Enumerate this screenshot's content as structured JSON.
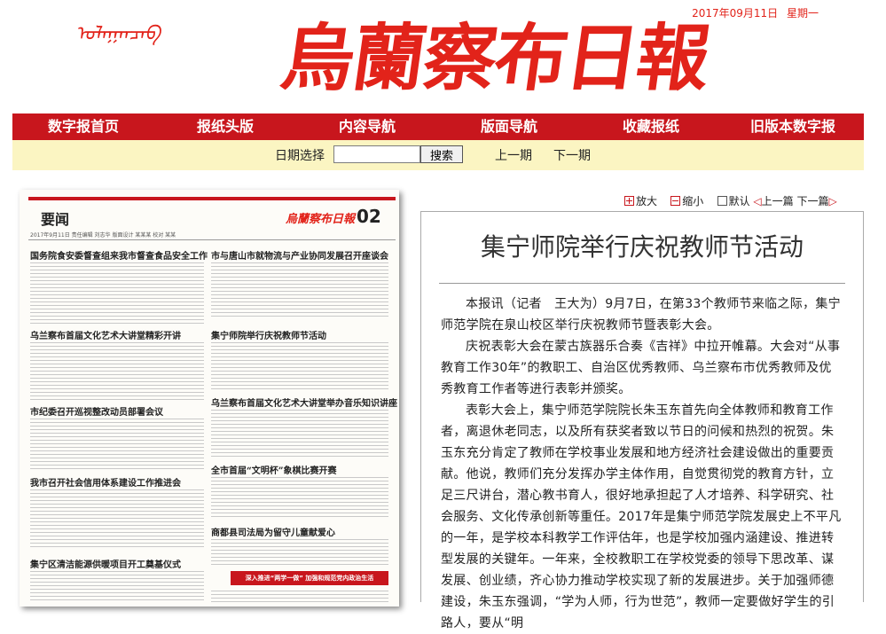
{
  "header": {
    "mongol_script": "ᠤᠯᠠᠭᠠᠨᠴᠠᠪ",
    "paper_name": "烏蘭察布日報",
    "date": "2017年09月11日",
    "weekday": "星期一",
    "brand_color": "#e2231a"
  },
  "nav": {
    "items": [
      "数字报首页",
      "报纸头版",
      "内容导航",
      "版面导航",
      "收藏报纸",
      "旧版本数字报"
    ]
  },
  "datebar": {
    "label": "日期选择",
    "input_value": "",
    "search_label": "搜索",
    "prev_label": "上一期",
    "next_label": "下一期"
  },
  "page_thumb": {
    "section": "要闻",
    "logo": "烏蘭察布日報",
    "page_number": "02",
    "dateline": "2017年9月11日  责任编辑 刘志华  版面设计 某某某  校对 某某",
    "headlines": [
      "国务院食安委督查组来我市督查食品安全工作",
      "市与唐山市就物流与产业协同发展召开座谈会",
      "乌兰察布首届文化艺术大讲堂精彩开讲",
      "集宁师院举行庆祝教师节活动",
      "乌兰察布首届文化艺术大讲堂举办音乐知识讲座",
      "市纪委召开巡视整改动员部署会议",
      "全市首届“文明杯”象棋比赛开赛",
      "我市召开社会信用体系建设工作推进会",
      "商都县司法局为留守儿童献爱心",
      "集宁区清洁能源供暖项目开工奠基仪式"
    ],
    "banner": "深入推进“两学一做” 加强和规范党内政治生活"
  },
  "toolbar": {
    "zoom_in": "放大",
    "zoom_out": "缩小",
    "default": "默认",
    "prev_article": "上一篇",
    "next_article": "下一篇"
  },
  "article": {
    "title": "集宁师院举行庆祝教师节活动",
    "paragraphs": [
      "本报讯（记者　王大为）9月7日，在第33个教师节来临之际，集宁师范学院在泉山校区举行庆祝教师节暨表彰大会。",
      "庆祝表彰大会在蒙古族器乐合奏《吉祥》中拉开帷幕。大会对“从事教育工作30年”的教职工、自治区优秀教师、乌兰察布市优秀教师及优秀教育工作者等进行表彰并颁奖。",
      "表彰大会上，集宁师范学院院长朱玉东首先向全体教师和教育工作者，离退休老同志，以及所有获奖者致以节日的问候和热烈的祝贺。朱玉东充分肯定了教师在学校事业发展和地方经济社会建设做出的重要贡献。他说，教师们充分发挥办学主体作用，自觉贯彻党的教育方针，立足三尺讲台，潜心教书育人，很好地承担起了人才培养、科学研究、社会服务、文化传承创新等重任。2017年是集宁师范学院发展史上不平凡的一年，是学校本科教学工作评估年，也是学校加强内涵建设、推进转型发展的关键年。一年来，全校教职工在学校党委的领导下思改革、谋发展、创业绩，齐心协力推动学校实现了新的发展进步。关于加强师德建设，朱玉东强调，“学为人师，行为世范”，教师一定要做好学生的引路人，要从“明"
    ]
  }
}
